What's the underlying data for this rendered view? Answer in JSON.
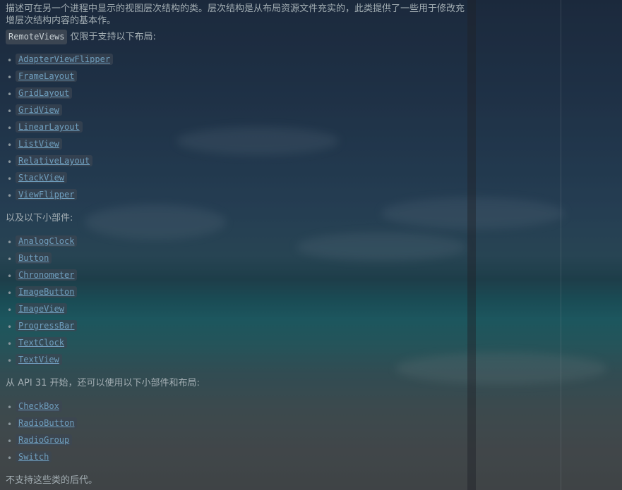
{
  "description": "描述可在另一个进程中显示的视图层次结构的类。层次结构是从布局资源文件充实的，此类提供了一些用于修改充增层次结构内容的基本作。",
  "intro": {
    "code": "RemoteViews",
    "text": "仅限于支持以下布局:"
  },
  "layouts": [
    "AdapterViewFlipper",
    "FrameLayout",
    "GridLayout",
    "GridView",
    "LinearLayout",
    "ListView",
    "RelativeLayout",
    "StackView",
    "ViewFlipper"
  ],
  "widgets_heading": "以及以下小部件:",
  "widgets": [
    "AnalogClock",
    "Button",
    "Chronometer",
    "ImageButton",
    "ImageView",
    "ProgressBar",
    "TextClock",
    "TextView"
  ],
  "api31_heading": "从 API 31 开始，还可以使用以下小部件和布局:",
  "api31_items": [
    "CheckBox",
    "RadioButton",
    "RadioGroup",
    "Switch"
  ],
  "footer": "不支持这些类的后代。",
  "colors": {
    "link": "#6f9fbf",
    "text": "#a3aeb3",
    "chip_bg": "#464e58"
  }
}
